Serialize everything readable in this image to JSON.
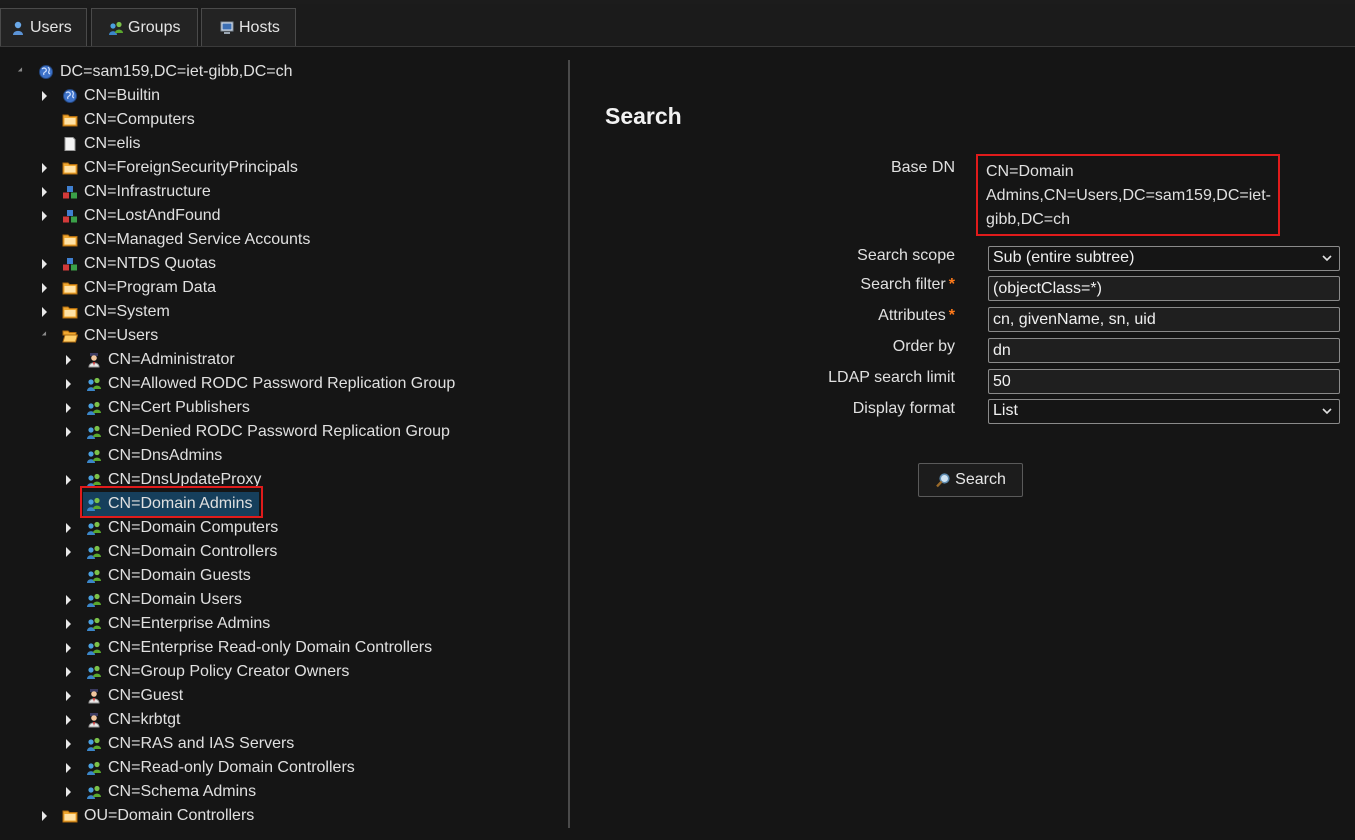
{
  "tabs": [
    {
      "label": "Users",
      "icon": "user-icon"
    },
    {
      "label": "Groups",
      "icon": "group-icon"
    },
    {
      "label": "Hosts",
      "icon": "computer-icon"
    }
  ],
  "tree": {
    "root": "DC=sam159,DC=iet-gibb,DC=ch",
    "level1": [
      {
        "label": "CN=Builtin",
        "icon": "globe-icon",
        "state": "collapsed"
      },
      {
        "label": "CN=Computers",
        "icon": "folder-icon",
        "state": "leaf"
      },
      {
        "label": "CN=elis",
        "icon": "document-icon",
        "state": "leaf"
      },
      {
        "label": "CN=ForeignSecurityPrincipals",
        "icon": "folder-icon",
        "state": "collapsed"
      },
      {
        "label": "CN=Infrastructure",
        "icon": "blocks-icon",
        "state": "collapsed"
      },
      {
        "label": "CN=LostAndFound",
        "icon": "blocks-icon",
        "state": "collapsed"
      },
      {
        "label": "CN=Managed Service Accounts",
        "icon": "folder-icon",
        "state": "leaf"
      },
      {
        "label": "CN=NTDS Quotas",
        "icon": "blocks-icon",
        "state": "collapsed"
      },
      {
        "label": "CN=Program Data",
        "icon": "folder-icon",
        "state": "collapsed"
      },
      {
        "label": "CN=System",
        "icon": "folder-icon",
        "state": "collapsed"
      },
      {
        "label": "CN=Users",
        "icon": "folder-open-icon",
        "state": "expanded"
      }
    ],
    "users_children": [
      {
        "label": "CN=Administrator",
        "icon": "person-icon",
        "state": "collapsed"
      },
      {
        "label": "CN=Allowed RODC Password Replication Group",
        "icon": "group-icon",
        "state": "collapsed"
      },
      {
        "label": "CN=Cert Publishers",
        "icon": "group-icon",
        "state": "collapsed"
      },
      {
        "label": "CN=Denied RODC Password Replication Group",
        "icon": "group-icon",
        "state": "collapsed"
      },
      {
        "label": "CN=DnsAdmins",
        "icon": "group-icon",
        "state": "leaf"
      },
      {
        "label": "CN=DnsUpdateProxy",
        "icon": "group-icon",
        "state": "collapsed"
      },
      {
        "label": "CN=Domain Admins",
        "icon": "group-icon",
        "state": "selected"
      },
      {
        "label": "CN=Domain Computers",
        "icon": "group-icon",
        "state": "collapsed"
      },
      {
        "label": "CN=Domain Controllers",
        "icon": "group-icon",
        "state": "collapsed"
      },
      {
        "label": "CN=Domain Guests",
        "icon": "group-icon",
        "state": "leaf"
      },
      {
        "label": "CN=Domain Users",
        "icon": "group-icon",
        "state": "collapsed"
      },
      {
        "label": "CN=Enterprise Admins",
        "icon": "group-icon",
        "state": "collapsed"
      },
      {
        "label": "CN=Enterprise Read-only Domain Controllers",
        "icon": "group-icon",
        "state": "collapsed"
      },
      {
        "label": "CN=Group Policy Creator Owners",
        "icon": "group-icon",
        "state": "collapsed"
      },
      {
        "label": "CN=Guest",
        "icon": "person-icon",
        "state": "collapsed"
      },
      {
        "label": "CN=krbtgt",
        "icon": "person-icon",
        "state": "collapsed"
      },
      {
        "label": "CN=RAS and IAS Servers",
        "icon": "group-icon",
        "state": "collapsed"
      },
      {
        "label": "CN=Read-only Domain Controllers",
        "icon": "group-icon",
        "state": "collapsed"
      },
      {
        "label": "CN=Schema Admins",
        "icon": "group-icon",
        "state": "collapsed"
      }
    ],
    "after_users": [
      {
        "label": "OU=Domain Controllers",
        "icon": "folder-icon",
        "state": "collapsed"
      }
    ]
  },
  "search_form": {
    "title": "Search",
    "base_dn_label": "Base DN",
    "base_dn_value": "CN=Domain Admins,CN=Users,DC=sam159,DC=iet-gibb,DC=ch",
    "scope_label": "Search scope",
    "scope_value": "Sub (entire subtree)",
    "filter_label": "Search filter",
    "filter_value": "(objectClass=*)",
    "attributes_label": "Attributes",
    "attributes_value": "cn, givenName, sn, uid",
    "order_label": "Order by",
    "order_value": "dn",
    "limit_label": "LDAP search limit",
    "limit_value": "50",
    "format_label": "Display format",
    "format_value": "List",
    "required_marker": "*",
    "button_label": "Search",
    "button_icon": "magnifier-icon"
  },
  "colors": {
    "background": "#151515",
    "highlight_border": "#e01b1b",
    "selected_bg": "#163f5c",
    "required": "#ff7a1a"
  }
}
